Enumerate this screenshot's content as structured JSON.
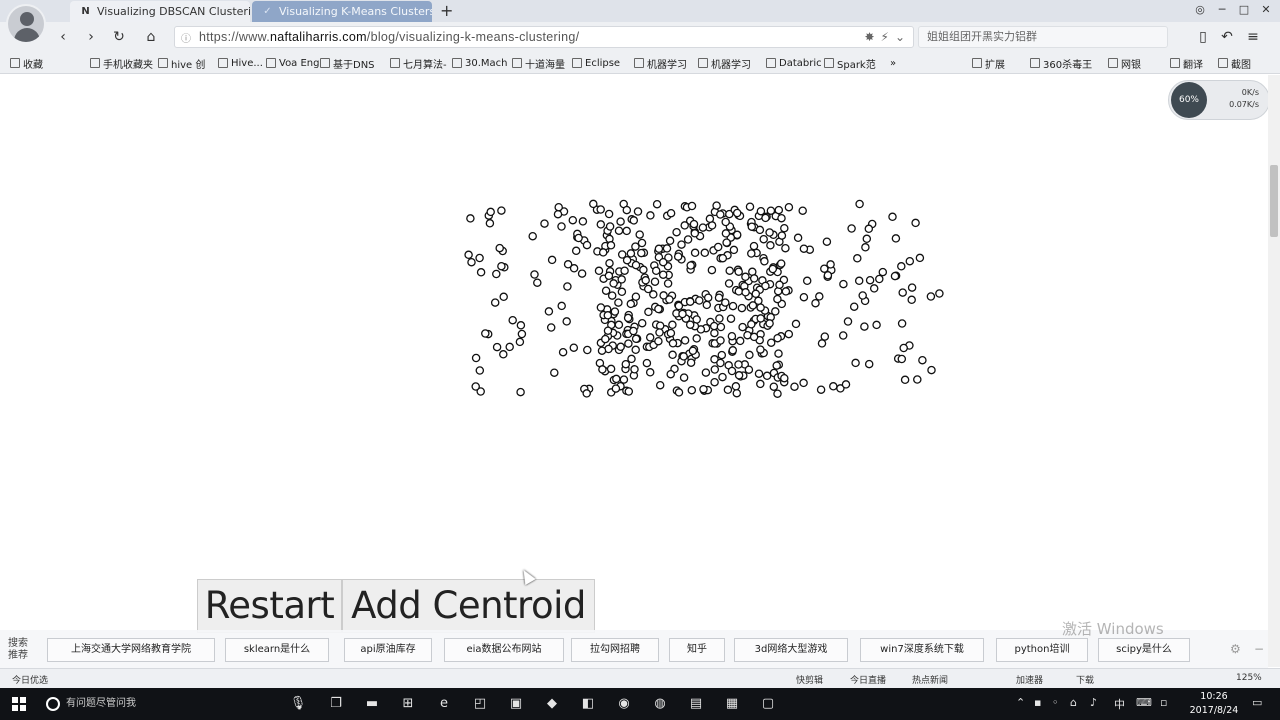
{
  "browser": {
    "tabs": [
      {
        "label": "Visualizing DBSCAN Clustering",
        "favicon": "N"
      },
      {
        "label": "Visualizing K-Means Clusters",
        "favicon": "✓"
      }
    ],
    "new_tab": "+",
    "address": {
      "prefix": "https://www.",
      "domain": "naftaliharris.com",
      "path": "/blog/visualizing-k-means-clustering/"
    },
    "search_suggestion": "姐姐组团开黑实力铝群",
    "bookmarks": [
      {
        "label": "收藏"
      },
      {
        "label": "手机收藏夹"
      },
      {
        "label": "hive 创"
      },
      {
        "label": "Hive..."
      },
      {
        "label": "Voa Eng"
      },
      {
        "label": "基于DNS"
      },
      {
        "label": "七月算法-"
      },
      {
        "label": "30.Mach"
      },
      {
        "label": "十道海量"
      },
      {
        "label": "Eclipse"
      },
      {
        "label": "机器学习"
      },
      {
        "label": "机器学习"
      },
      {
        "label": "Databric"
      },
      {
        "label": "Spark范"
      },
      {
        "label": "»"
      }
    ],
    "bookmarks_right": [
      {
        "label": "扩展"
      },
      {
        "label": "360杀毒王"
      },
      {
        "label": "网银"
      },
      {
        "label": "翻译"
      },
      {
        "label": "截图"
      }
    ],
    "speed_widget": {
      "percent": "60%",
      "up": "0K/s",
      "down": "0.07K/s"
    }
  },
  "page": {
    "buttons": {
      "restart": "Restart",
      "add_centroid": "Add Centroid"
    }
  },
  "scatter": {
    "seed": 24817,
    "regions": [
      {
        "kind": "uniform",
        "count": 220,
        "x": [
          468,
          942
        ],
        "y": [
          202,
          394
        ]
      },
      {
        "kind": "dense",
        "count": 300,
        "x": [
          598,
          790
        ],
        "y": [
          204,
          394
        ]
      }
    ]
  },
  "hotsearch": {
    "label": "搜索推荐",
    "items": [
      "上海交通大学网络教育学院",
      "sklearn是什么",
      "api原油库存",
      "eia数据公布网站",
      "拉勾网招聘",
      "知乎",
      "3d网络大型游戏",
      "win7深度系统下载",
      "python培训",
      "scipy是什么"
    ],
    "watermark": "激活 Windows"
  },
  "statusbar": {
    "left": "今日优选",
    "items": [
      "快剪辑",
      "今日直播",
      "热点新闻",
      "加速器",
      "下载",
      "125%"
    ]
  },
  "taskbar": {
    "search_placeholder": "有问题尽管问我",
    "clock_time": "10:26",
    "clock_date": "2017/8/24",
    "ime": "中"
  }
}
